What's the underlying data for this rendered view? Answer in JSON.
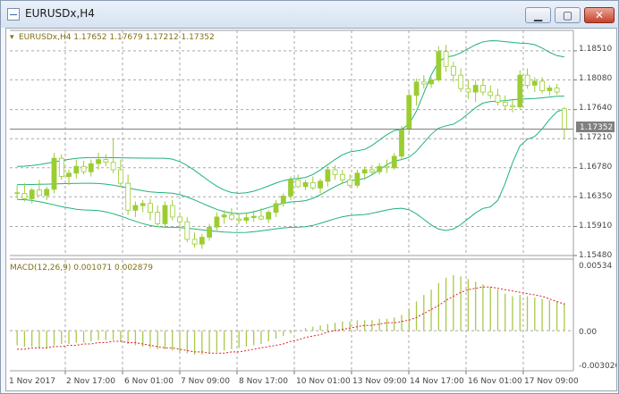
{
  "window": {
    "title": "EURUSDx,H4",
    "minimize_glyph": "▁",
    "maximize_glyph": "▢",
    "close_glyph": "✕"
  },
  "main_chart": {
    "info_label": "EURUSDx,H4  1.17652 1.17679 1.17212 1.17352",
    "current_price_label": "1.17352",
    "price_ticks": [
      "1.18510",
      "1.18080",
      "1.17640",
      "1.17210",
      "1.16780",
      "1.16350",
      "1.15910",
      "1.15480"
    ]
  },
  "indicator": {
    "info_label": "MACD(12,26,9) 0.001071 0.002879",
    "ticks": [
      "0.00534",
      "0.00",
      "-0.003026"
    ]
  },
  "time_axis": {
    "labels": [
      "1 Nov 2017",
      "2 Nov 17:00",
      "6 Nov 01:00",
      "7 Nov 09:00",
      "8 Nov 17:00",
      "10 Nov 01:00",
      "13 Nov 09:00",
      "14 Nov 17:00",
      "16 Nov 01:00",
      "17 Nov 09:00"
    ]
  },
  "colors": {
    "grid": "#a9a9a9",
    "bull_candle": "#9acd32",
    "bear_candle": "#ffffff",
    "bands": "#20b27a",
    "macd_bars": "#a8c94a",
    "macd_signal": "#e02020",
    "axis_text": "#444444",
    "price_line": "#808080"
  },
  "chart_data": {
    "type": "candlestick",
    "symbol": "EURUSDx",
    "timeframe": "H4",
    "ohlc": [
      [
        1.1641,
        1.1652,
        1.1632,
        1.164
      ],
      [
        1.164,
        1.1655,
        1.1628,
        1.1632
      ],
      [
        1.1632,
        1.1648,
        1.1625,
        1.1645
      ],
      [
        1.1645,
        1.166,
        1.1638,
        1.1637
      ],
      [
        1.1637,
        1.165,
        1.163,
        1.1646
      ],
      [
        1.1646,
        1.17,
        1.164,
        1.1692
      ],
      [
        1.1692,
        1.1698,
        1.166,
        1.1665
      ],
      [
        1.1665,
        1.1675,
        1.1652,
        1.167
      ],
      [
        1.167,
        1.169,
        1.1662,
        1.168
      ],
      [
        1.168,
        1.1688,
        1.1668,
        1.1672
      ],
      [
        1.1672,
        1.169,
        1.1665,
        1.1684
      ],
      [
        1.1684,
        1.17,
        1.1675,
        1.169
      ],
      [
        1.169,
        1.1698,
        1.168,
        1.1686
      ],
      [
        1.1686,
        1.172,
        1.167,
        1.1675
      ],
      [
        1.1675,
        1.169,
        1.165,
        1.1655
      ],
      [
        1.1655,
        1.1668,
        1.1608,
        1.1615
      ],
      [
        1.1615,
        1.1628,
        1.1605,
        1.1622
      ],
      [
        1.1622,
        1.163,
        1.1612,
        1.1625
      ],
      [
        1.1625,
        1.1632,
        1.16,
        1.1612
      ],
      [
        1.1612,
        1.1622,
        1.159,
        1.1595
      ],
      [
        1.1595,
        1.1628,
        1.159,
        1.1622
      ],
      [
        1.1622,
        1.163,
        1.16,
        1.1605
      ],
      [
        1.1605,
        1.1612,
        1.159,
        1.1598
      ],
      [
        1.1598,
        1.1605,
        1.1568,
        1.1572
      ],
      [
        1.1572,
        1.1582,
        1.156,
        1.1565
      ],
      [
        1.1565,
        1.158,
        1.1558,
        1.1575
      ],
      [
        1.1575,
        1.1595,
        1.157,
        1.159
      ],
      [
        1.159,
        1.1612,
        1.1585,
        1.1605
      ],
      [
        1.1605,
        1.1615,
        1.1595,
        1.1608
      ],
      [
        1.1608,
        1.1618,
        1.16,
        1.1602
      ],
      [
        1.1602,
        1.161,
        1.1595,
        1.16
      ],
      [
        1.16,
        1.1612,
        1.1595,
        1.1604
      ],
      [
        1.1604,
        1.1615,
        1.1598,
        1.1606
      ],
      [
        1.1606,
        1.1618,
        1.16,
        1.1602
      ],
      [
        1.1602,
        1.1615,
        1.1596,
        1.1612
      ],
      [
        1.1612,
        1.163,
        1.1605,
        1.1625
      ],
      [
        1.1625,
        1.164,
        1.162,
        1.1636
      ],
      [
        1.1636,
        1.1665,
        1.163,
        1.166
      ],
      [
        1.166,
        1.1668,
        1.1648,
        1.165
      ],
      [
        1.165,
        1.166,
        1.1645,
        1.1656
      ],
      [
        1.1656,
        1.1665,
        1.1645,
        1.1648
      ],
      [
        1.1648,
        1.1662,
        1.164,
        1.1658
      ],
      [
        1.1658,
        1.168,
        1.165,
        1.1675
      ],
      [
        1.1675,
        1.1682,
        1.166,
        1.1668
      ],
      [
        1.1668,
        1.1675,
        1.1655,
        1.166
      ],
      [
        1.166,
        1.1668,
        1.1648,
        1.1652
      ],
      [
        1.1652,
        1.1675,
        1.1648,
        1.167
      ],
      [
        1.167,
        1.168,
        1.166,
        1.1675
      ],
      [
        1.1675,
        1.1682,
        1.1668,
        1.1672
      ],
      [
        1.1672,
        1.1685,
        1.1668,
        1.168
      ],
      [
        1.168,
        1.169,
        1.167,
        1.1678
      ],
      [
        1.1678,
        1.17,
        1.1675,
        1.1695
      ],
      [
        1.1695,
        1.174,
        1.169,
        1.1735
      ],
      [
        1.1735,
        1.179,
        1.173,
        1.1785
      ],
      [
        1.1785,
        1.181,
        1.177,
        1.1805
      ],
      [
        1.1805,
        1.1815,
        1.1795,
        1.1802
      ],
      [
        1.1802,
        1.1812,
        1.1796,
        1.1808
      ],
      [
        1.1808,
        1.1858,
        1.1805,
        1.185
      ],
      [
        1.185,
        1.186,
        1.182,
        1.1828
      ],
      [
        1.1828,
        1.1835,
        1.1805,
        1.1815
      ],
      [
        1.1815,
        1.1825,
        1.179,
        1.1795
      ],
      [
        1.1795,
        1.1808,
        1.178,
        1.179
      ],
      [
        1.179,
        1.1808,
        1.1775,
        1.18
      ],
      [
        1.18,
        1.181,
        1.1785,
        1.179
      ],
      [
        1.179,
        1.18,
        1.178,
        1.1785
      ],
      [
        1.1785,
        1.1795,
        1.177,
        1.1775
      ],
      [
        1.1775,
        1.1785,
        1.1765,
        1.177
      ],
      [
        1.177,
        1.178,
        1.176,
        1.1768
      ],
      [
        1.1768,
        1.1822,
        1.1765,
        1.1815
      ],
      [
        1.1815,
        1.1825,
        1.1795,
        1.18
      ],
      [
        1.18,
        1.1812,
        1.179,
        1.1806
      ],
      [
        1.1806,
        1.1812,
        1.1788,
        1.1792
      ],
      [
        1.1792,
        1.18,
        1.1785,
        1.1796
      ],
      [
        1.1796,
        1.1802,
        1.1786,
        1.179
      ],
      [
        1.17652,
        1.17679,
        1.17212,
        1.17352
      ]
    ],
    "macd_histogram": [
      -0.0011,
      -0.0012,
      -0.0012,
      -0.0013,
      -0.0013,
      -0.0011,
      -0.001,
      -0.001,
      -0.0009,
      -0.0009,
      -0.0008,
      -0.0007,
      -0.0007,
      -0.0007,
      -0.0008,
      -0.001,
      -0.0011,
      -0.0012,
      -0.0013,
      -0.0014,
      -0.0014,
      -0.0015,
      -0.0016,
      -0.0017,
      -0.0018,
      -0.0018,
      -0.0017,
      -0.0016,
      -0.0015,
      -0.0014,
      -0.0013,
      -0.0012,
      -0.0011,
      -0.001,
      -0.0008,
      -0.0006,
      -0.0004,
      -0.0002,
      0.0,
      0.0002,
      0.0003,
      0.0004,
      0.0005,
      0.0006,
      0.0007,
      0.0007,
      0.0008,
      0.0008,
      0.0008,
      0.0009,
      0.0009,
      0.001,
      0.0012,
      0.0016,
      0.0022,
      0.0027,
      0.0031,
      0.0036,
      0.004,
      0.0042,
      0.0041,
      0.0039,
      0.0037,
      0.0035,
      0.0033,
      0.0031,
      0.0028,
      0.0026,
      0.0027,
      0.0026,
      0.0025,
      0.0024,
      0.0023,
      0.0022,
      0.0021
    ],
    "macd_signal": [
      -0.0014,
      -0.0014,
      -0.0013,
      -0.0013,
      -0.0013,
      -0.0012,
      -0.0012,
      -0.0011,
      -0.0011,
      -0.001,
      -0.001,
      -0.0009,
      -0.0009,
      -0.0008,
      -0.0008,
      -0.0009,
      -0.0009,
      -0.001,
      -0.0011,
      -0.0012,
      -0.0013,
      -0.0013,
      -0.0014,
      -0.0015,
      -0.0016,
      -0.0016,
      -0.0017,
      -0.0017,
      -0.0017,
      -0.0016,
      -0.0016,
      -0.0015,
      -0.0014,
      -0.0013,
      -0.0012,
      -0.0011,
      -0.001,
      -0.0008,
      -0.0007,
      -0.0005,
      -0.0004,
      -0.0003,
      -0.0001,
      0.0,
      0.0001,
      0.0002,
      0.0003,
      0.0004,
      0.0004,
      0.0005,
      0.0006,
      0.0006,
      0.0007,
      0.0008,
      0.001,
      0.0013,
      0.0016,
      0.0019,
      0.0023,
      0.0026,
      0.0029,
      0.0031,
      0.0032,
      0.0033,
      0.0033,
      0.0032,
      0.0031,
      0.003,
      0.0029,
      0.0028,
      0.0027,
      0.0026,
      0.0024,
      0.0022,
      0.002
    ],
    "bollinger": {
      "middle_x": [
        0,
        10,
        20,
        30,
        38,
        46,
        52,
        58,
        64,
        69,
        74
      ],
      "middle": [
        1.1653,
        1.1655,
        1.1641,
        1.161,
        1.1628,
        1.166,
        1.169,
        1.174,
        1.1776,
        1.178,
        1.1784
      ],
      "upper": [
        1.168,
        1.1693,
        1.1692,
        1.164,
        1.1662,
        1.1703,
        1.1735,
        1.1842,
        1.1866,
        1.1862,
        1.1842
      ],
      "lower": [
        1.1631,
        1.1615,
        1.159,
        1.1582,
        1.159,
        1.1608,
        1.1618,
        1.1585,
        1.162,
        1.172,
        1.1765
      ]
    },
    "y_range": [
      1.1548,
      1.1876
    ],
    "macd_range": [
      -0.003026,
      0.00534
    ],
    "current_price": 1.17352,
    "grid": true
  }
}
